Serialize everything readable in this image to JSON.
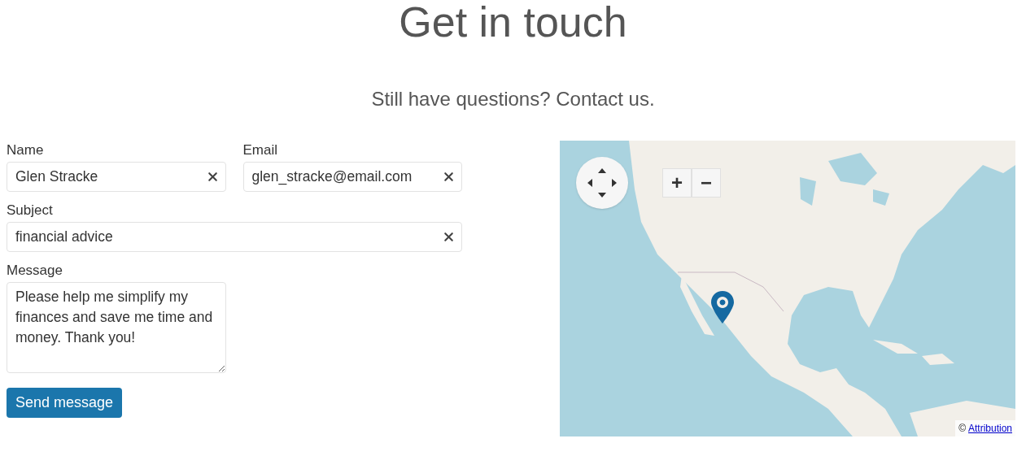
{
  "heading": "Get in touch",
  "subtitle": "Still have questions? Contact us.",
  "form": {
    "rows": [
      [
        {
          "kind": "input",
          "label": "Name",
          "value": "Glen Stracke"
        },
        {
          "kind": "input",
          "label": "Email",
          "value": "glen_stracke@email.com"
        }
      ],
      [
        {
          "kind": "input",
          "label": "Subject",
          "value": "financial advice"
        }
      ],
      [
        {
          "kind": "textarea",
          "label": "Message",
          "value": "Please help me simplify my finances and save me time and money. Thank you!"
        }
      ]
    ],
    "submit": "Send message"
  },
  "map": {
    "zoom_buttons": [
      "+",
      "−"
    ],
    "attribution": {
      "prefix": "©",
      "link": "Attribution"
    }
  }
}
